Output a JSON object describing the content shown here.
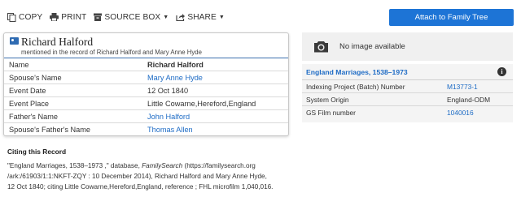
{
  "toolbar": {
    "copy": "COPY",
    "print": "PRINT",
    "source_box": "SOURCE BOX",
    "share": "SHARE"
  },
  "attach_button": "Attach to Family Tree",
  "record": {
    "name": "Richard Halford",
    "subtitle": "mentioned in the record of Richard Halford and Mary Anne Hyde",
    "rows": [
      {
        "label": "Name",
        "value": "Richard Halford"
      },
      {
        "label": "Spouse's Name",
        "value": "Mary Anne Hyde"
      },
      {
        "label": "Event Date",
        "value": "12 Oct 1840"
      },
      {
        "label": "Event Place",
        "value": "Little Cowarne,Hereford,England"
      },
      {
        "label": "Father's Name",
        "value": "John Halford"
      },
      {
        "label": "Spouse's Father's Name",
        "value": "Thomas Allen"
      }
    ]
  },
  "image_panel": {
    "text": "No image available"
  },
  "collection": {
    "title": "England Marriages, 1538–1973",
    "rows": [
      {
        "label": "Indexing Project (Batch) Number",
        "value": "M13773-1"
      },
      {
        "label": "System Origin",
        "value": "England-ODM"
      },
      {
        "label": "GS Film number",
        "value": "1040016"
      }
    ]
  },
  "citing": {
    "title": "Citing this Record",
    "part1": "\"England Marriages, 1538–1973 ,\" database, ",
    "italic": "FamilySearch",
    "part2": " (https://familysearch.org",
    "line2": "/ark:/61903/1:1:NKFT-ZQY : 10 December 2014), Richard Halford and Mary Anne Hyde,",
    "line3": "12 Oct 1840; citing Little Cowarne,Hereford,England, reference ; FHL microfilm 1,040,016."
  },
  "colors": {
    "accent": "#1d74d6",
    "link": "#1d6bc5"
  }
}
